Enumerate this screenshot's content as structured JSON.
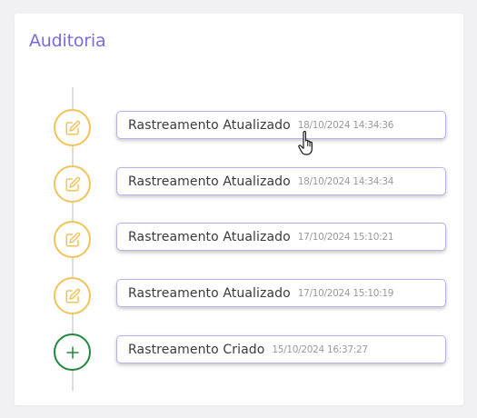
{
  "panel": {
    "title": "Auditoria"
  },
  "colors": {
    "title": "#7b6be0",
    "edit_marker": "#f3c35a",
    "create_marker": "#1f8a3c",
    "entry_border": "#b8b2ea"
  },
  "timeline": [
    {
      "event": "Rastreamento Atualizado",
      "timestamp": "18/10/2024 14:34:36",
      "icon": "edit-icon"
    },
    {
      "event": "Rastreamento Atualizado",
      "timestamp": "18/10/2024 14:34:34",
      "icon": "edit-icon"
    },
    {
      "event": "Rastreamento Atualizado",
      "timestamp": "17/10/2024 15:10:21",
      "icon": "edit-icon"
    },
    {
      "event": "Rastreamento Atualizado",
      "timestamp": "17/10/2024 15:10:19",
      "icon": "edit-icon"
    },
    {
      "event": "Rastreamento Criado",
      "timestamp": "15/10/2024 16:37:27",
      "icon": "plus-icon"
    }
  ]
}
